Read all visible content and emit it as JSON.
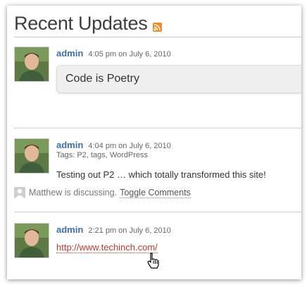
{
  "header": {
    "title": "Recent Updates",
    "rss_icon": "rss-feed-icon"
  },
  "posts": [
    {
      "author": "admin",
      "time": "4:05 pm on July 6, 2010",
      "content": "Code is Poetry"
    },
    {
      "author": "admin",
      "time": "4:04 pm on July 6, 2010",
      "tags": "Tags: P2, tags, WordPress",
      "content": "Testing out P2 … which totally transformed this site!",
      "discussion": {
        "text": "Matthew is discussing.",
        "toggle": "Toggle Comments"
      }
    },
    {
      "author": "admin",
      "time": "2:21 pm on July 6, 2010",
      "link": "http://www.techinch.com/"
    }
  ],
  "colors": {
    "author": "#3d6fa8",
    "link": "#c0392b",
    "rss": "#f38b24"
  }
}
